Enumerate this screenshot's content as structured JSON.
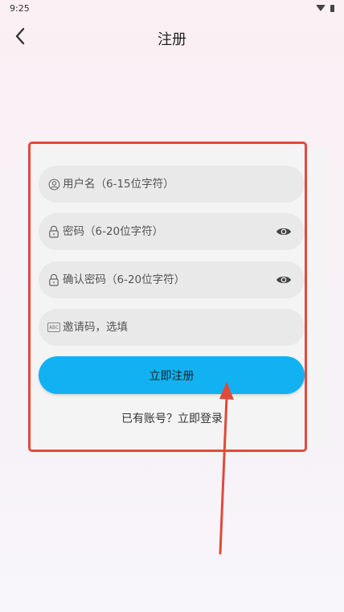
{
  "status_bar": {
    "time": "9:25",
    "icons": [
      "wifi-icon",
      "battery-icon"
    ]
  },
  "header": {
    "title": "注册",
    "back_icon": "chevron-left-icon"
  },
  "form": {
    "username": {
      "value": "",
      "placeholder": "用户名（6-15位字符）",
      "icon": "user-icon"
    },
    "password": {
      "value": "",
      "placeholder": "密码（6-20位字符）",
      "icon": "lock-icon",
      "toggle_icon": "eye-icon"
    },
    "confirm_password": {
      "value": "",
      "placeholder": "确认密码（6-20位字符）",
      "icon": "lock-icon",
      "toggle_icon": "eye-icon"
    },
    "invite_code": {
      "value": "",
      "placeholder": "邀请码，选填",
      "icon": "abc-icon",
      "icon_text": "ABC"
    },
    "submit_label": "立即注册",
    "login_link": "已有账号？立即登录"
  },
  "annotation": {
    "highlight_color": "#e04a3a"
  },
  "colors": {
    "primary_button": "#12b1f2",
    "field_background": "#e9e9e9",
    "card_background": "#f4f4f4"
  }
}
